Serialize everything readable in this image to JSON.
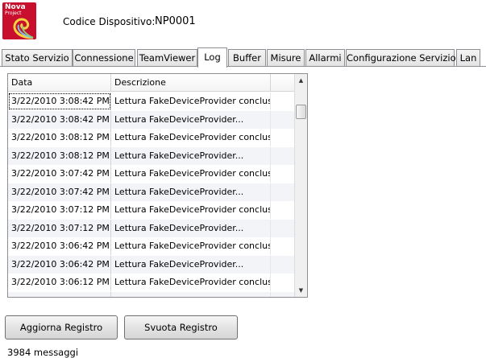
{
  "header": {
    "logo_text": "Nova",
    "logo_sub": "Project",
    "device_label": "Codice Dispositivo:",
    "device_code": "NP0001"
  },
  "tabs": [
    {
      "label": "Stato Servizio",
      "active": false
    },
    {
      "label": "Connessione",
      "active": false
    },
    {
      "label": "TeamViewer",
      "active": false
    },
    {
      "label": "Log",
      "active": true
    },
    {
      "label": "Buffer",
      "active": false
    },
    {
      "label": "Misure",
      "active": false
    },
    {
      "label": "Allarmi",
      "active": false
    },
    {
      "label": "Configurazione Servizio",
      "active": false
    },
    {
      "label": "Lan",
      "active": false
    }
  ],
  "log": {
    "columns": [
      "Data",
      "Descrizione"
    ],
    "rows": [
      {
        "date": "3/22/2010 3:08:42 PM",
        "desc": "Lettura FakeDeviceProvider conclusa"
      },
      {
        "date": "3/22/2010 3:08:42 PM",
        "desc": "Lettura FakeDeviceProvider..."
      },
      {
        "date": "3/22/2010 3:08:12 PM",
        "desc": "Lettura FakeDeviceProvider conclusa"
      },
      {
        "date": "3/22/2010 3:08:12 PM",
        "desc": "Lettura FakeDeviceProvider..."
      },
      {
        "date": "3/22/2010 3:07:42 PM",
        "desc": "Lettura FakeDeviceProvider conclusa"
      },
      {
        "date": "3/22/2010 3:07:42 PM",
        "desc": "Lettura FakeDeviceProvider..."
      },
      {
        "date": "3/22/2010 3:07:12 PM",
        "desc": "Lettura FakeDeviceProvider conclusa"
      },
      {
        "date": "3/22/2010 3:07:12 PM",
        "desc": "Lettura FakeDeviceProvider..."
      },
      {
        "date": "3/22/2010 3:06:42 PM",
        "desc": "Lettura FakeDeviceProvider conclusa"
      },
      {
        "date": "3/22/2010 3:06:42 PM",
        "desc": "Lettura FakeDeviceProvider..."
      },
      {
        "date": "3/22/2010 3:06:12 PM",
        "desc": "Lettura FakeDeviceProvider conclusa"
      },
      {
        "date": "3/22/2010 3:06:12 PM",
        "desc": "Lettura FakeDeviceProvider..."
      }
    ],
    "selected_index": 0
  },
  "buttons": {
    "refresh_label": "Aggiorna Registro",
    "clear_label": "Svuota Registro"
  },
  "status": {
    "message_count": "3984 messaggi"
  },
  "colors": {
    "logo_red": "#c8102e",
    "row_alt": "#f2f4f7",
    "border": "#8c8e94"
  },
  "icons": {
    "scroll_up": "scroll-up-arrow-icon",
    "scroll_down": "scroll-down-arrow-icon",
    "logo": "nova-shell-logo-icon"
  }
}
